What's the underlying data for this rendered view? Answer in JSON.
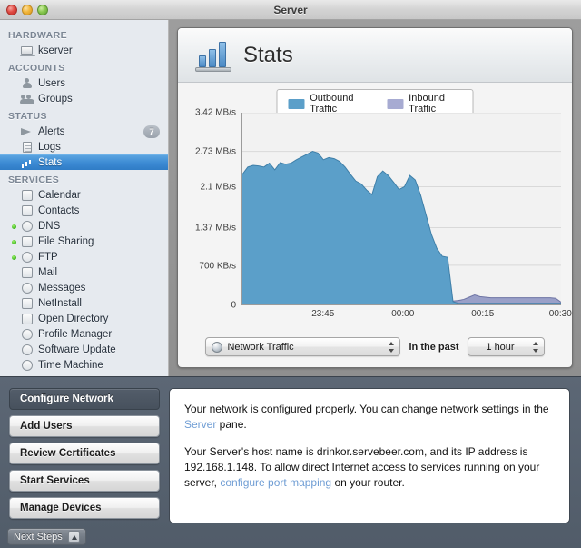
{
  "window": {
    "title": "Server",
    "traffic_lights": [
      "close-button",
      "minimize-button",
      "zoom-button"
    ]
  },
  "sidebar": {
    "groups": [
      {
        "label": "HARDWARE",
        "items": [
          {
            "label": "kserver",
            "icon": "laptop-icon",
            "selected": false,
            "dot": false,
            "badge": ""
          }
        ]
      },
      {
        "label": "ACCOUNTS",
        "items": [
          {
            "label": "Users",
            "icon": "person-icon",
            "selected": false,
            "dot": false,
            "badge": ""
          },
          {
            "label": "Groups",
            "icon": "people-icon",
            "selected": false,
            "dot": false,
            "badge": ""
          }
        ]
      },
      {
        "label": "STATUS",
        "items": [
          {
            "label": "Alerts",
            "icon": "megaphone-icon",
            "selected": false,
            "dot": false,
            "badge": "7"
          },
          {
            "label": "Logs",
            "icon": "document-icon",
            "selected": false,
            "dot": false,
            "badge": ""
          },
          {
            "label": "Stats",
            "icon": "bar-chart-icon",
            "selected": true,
            "dot": false,
            "badge": ""
          }
        ]
      },
      {
        "label": "SERVICES",
        "items": [
          {
            "label": "Calendar",
            "icon": "calendar-icon",
            "selected": false,
            "dot": false,
            "badge": ""
          },
          {
            "label": "Contacts",
            "icon": "contacts-icon",
            "selected": false,
            "dot": false,
            "badge": ""
          },
          {
            "label": "DNS",
            "icon": "dns-icon",
            "selected": false,
            "dot": true,
            "badge": ""
          },
          {
            "label": "File Sharing",
            "icon": "file-sharing-icon",
            "selected": false,
            "dot": true,
            "badge": ""
          },
          {
            "label": "FTP",
            "icon": "ftp-icon",
            "selected": false,
            "dot": true,
            "badge": ""
          },
          {
            "label": "Mail",
            "icon": "mail-icon",
            "selected": false,
            "dot": false,
            "badge": ""
          },
          {
            "label": "Messages",
            "icon": "messages-icon",
            "selected": false,
            "dot": false,
            "badge": ""
          },
          {
            "label": "NetInstall",
            "icon": "netinstall-icon",
            "selected": false,
            "dot": false,
            "badge": ""
          },
          {
            "label": "Open Directory",
            "icon": "open-directory-icon",
            "selected": false,
            "dot": false,
            "badge": ""
          },
          {
            "label": "Profile Manager",
            "icon": "profile-manager-icon",
            "selected": false,
            "dot": false,
            "badge": ""
          },
          {
            "label": "Software Update",
            "icon": "software-update-icon",
            "selected": false,
            "dot": false,
            "badge": ""
          },
          {
            "label": "Time Machine",
            "icon": "time-machine-icon",
            "selected": false,
            "dot": false,
            "badge": ""
          }
        ]
      }
    ]
  },
  "panel": {
    "title": "Stats",
    "icon": "bar-chart-icon"
  },
  "controls": {
    "metric_value": "Network Traffic",
    "middle_label": "in the past",
    "range_value": "1 hour"
  },
  "chart_data": {
    "type": "area",
    "title": "Network Traffic",
    "xlabel": "",
    "ylabel": "",
    "grid": true,
    "legend_position": "top-center",
    "colors": {
      "outbound": "#5b9fc9",
      "inbound": "#9aa0c8",
      "plot_bg": "#f2f2f2",
      "grid": "#d9d9d9"
    },
    "legend": [
      {
        "name": "Outbound Traffic",
        "color": "#5b9fc9"
      },
      {
        "name": "Inbound Traffic",
        "color": "#a7abd2"
      }
    ],
    "ylim": [
      0,
      3.42
    ],
    "yunit": "MB/s",
    "ytick_labels": [
      "3.42 MB/s",
      "2.73 MB/s",
      "2.1 MB/s",
      "1.37 MB/s",
      "700 KB/s",
      "0"
    ],
    "ytick_values": [
      3.42,
      2.73,
      2.1,
      1.37,
      0.7,
      0
    ],
    "xtick_labels": [
      "23:45",
      "00:00",
      "00:15",
      "00:30"
    ],
    "xtick_positions": [
      0.255,
      0.505,
      0.755,
      0.998
    ],
    "series": [
      {
        "name": "Outbound Traffic",
        "color": "#5b9fc9",
        "values": [
          2.32,
          2.45,
          2.48,
          2.47,
          2.45,
          2.52,
          2.4,
          2.53,
          2.5,
          2.52,
          2.58,
          2.63,
          2.68,
          2.73,
          2.7,
          2.58,
          2.62,
          2.6,
          2.55,
          2.45,
          2.32,
          2.2,
          2.15,
          2.04,
          1.96,
          2.28,
          2.38,
          2.3,
          2.18,
          2.05,
          2.1,
          2.3,
          2.22,
          1.95,
          1.6,
          1.25,
          1.0,
          0.86,
          0.84,
          0.05,
          0.02,
          0.02,
          0.02,
          0.02,
          0.02,
          0.02,
          0.02,
          0.02,
          0.02,
          0.02,
          0.02,
          0.02,
          0.02,
          0.02,
          0.02,
          0.02,
          0.02,
          0.02,
          0.02,
          0.02
        ]
      },
      {
        "name": "Inbound Traffic",
        "color": "#9aa0c8",
        "values": [
          0.05,
          0.05,
          0.05,
          0.05,
          0.05,
          0.05,
          0.05,
          0.05,
          0.05,
          0.05,
          0.05,
          0.05,
          0.05,
          0.05,
          0.05,
          0.05,
          0.05,
          0.05,
          0.05,
          0.05,
          0.05,
          0.05,
          0.05,
          0.05,
          0.05,
          0.05,
          0.05,
          0.05,
          0.05,
          0.06,
          0.06,
          0.06,
          0.06,
          0.06,
          0.06,
          0.06,
          0.06,
          0.06,
          0.06,
          0.06,
          0.07,
          0.09,
          0.13,
          0.17,
          0.14,
          0.13,
          0.12,
          0.12,
          0.12,
          0.12,
          0.12,
          0.12,
          0.12,
          0.12,
          0.12,
          0.12,
          0.12,
          0.12,
          0.11,
          0.04
        ]
      }
    ]
  },
  "drawer": {
    "steps": [
      {
        "label": "Configure Network",
        "selected": true
      },
      {
        "label": "Add Users",
        "selected": false
      },
      {
        "label": "Review Certificates",
        "selected": false
      },
      {
        "label": "Start Services",
        "selected": false
      },
      {
        "label": "Manage Devices",
        "selected": false
      }
    ],
    "info": {
      "p1_before": "Your network is configured properly. You can change network settings in the ",
      "p1_link": "Server",
      "p1_after": " pane.",
      "p2_before": "Your Server's host name is drinkor.servebeer.com, and its IP address is 192.168.1.148. To allow direct Internet access to services running on your server, ",
      "p2_link": "configure port mapping",
      "p2_after": " on your router."
    }
  },
  "statusbar": {
    "next_steps_label": "Next Steps"
  }
}
